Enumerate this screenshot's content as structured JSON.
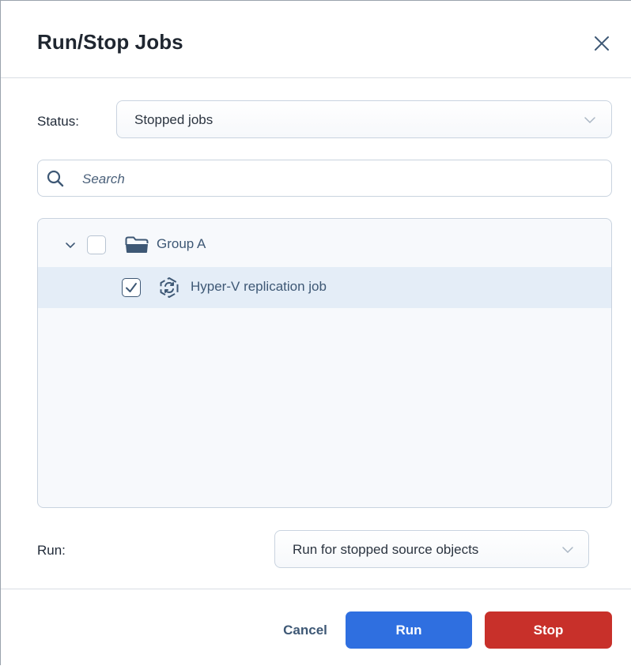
{
  "dialog": {
    "title": "Run/Stop Jobs"
  },
  "status": {
    "label": "Status:",
    "selected": "Stopped jobs"
  },
  "search": {
    "placeholder": "Search",
    "value": ""
  },
  "tree": {
    "items": [
      {
        "label": "Group A",
        "type": "folder",
        "expanded": true,
        "checked": false
      },
      {
        "label": "Hyper-V replication job",
        "type": "replication-job",
        "checked": true,
        "selected": true
      }
    ]
  },
  "run": {
    "label": "Run:",
    "selected": "Run for stopped source objects"
  },
  "footer": {
    "cancel_label": "Cancel",
    "run_label": "Run",
    "stop_label": "Stop"
  },
  "colors": {
    "primary": "#2f6fe0",
    "danger": "#c8302a",
    "selection": "#e4edf7",
    "text_accent": "#3e5875"
  },
  "icons": {
    "close": "close-icon",
    "chevron": "chevron-down-icon",
    "search": "search-icon",
    "folder": "folder-icon",
    "job": "replication-job-icon",
    "check": "checkmark-icon"
  }
}
